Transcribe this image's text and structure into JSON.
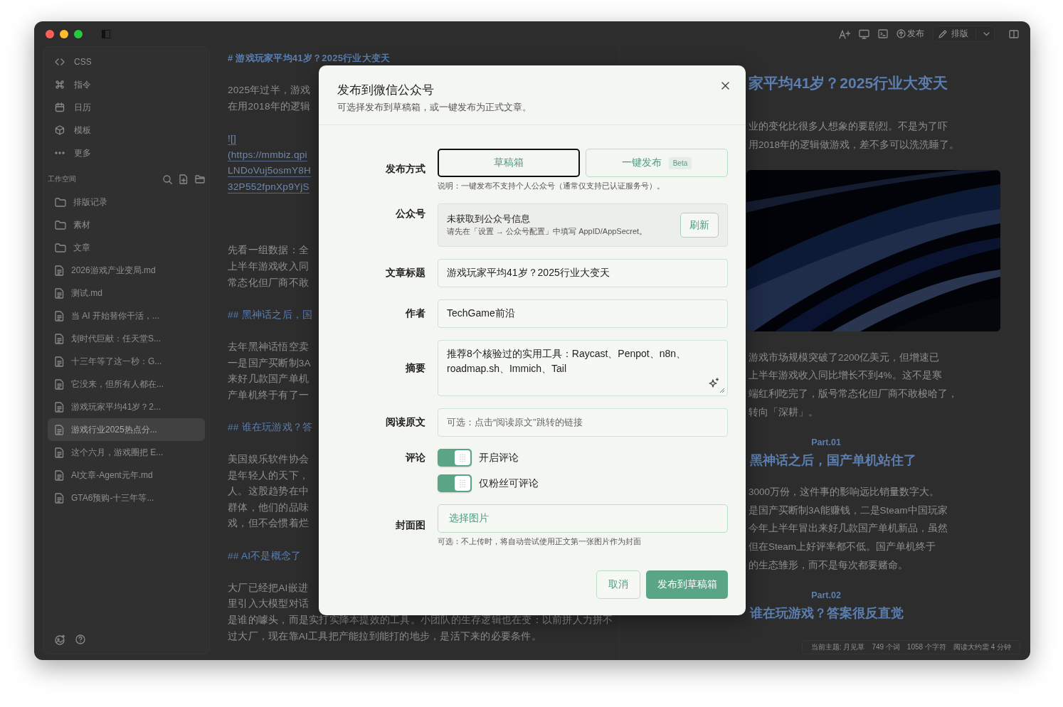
{
  "toolbar": {
    "publish": "发布",
    "layout": "排版"
  },
  "sidebar": {
    "nav": [
      {
        "kind": "code",
        "label": "CSS"
      },
      {
        "kind": "command",
        "label": "指令"
      },
      {
        "kind": "calendar",
        "label": "日历"
      },
      {
        "kind": "cube",
        "label": "模板"
      },
      {
        "kind": "more",
        "label": "更多"
      }
    ],
    "workspace": {
      "title": "工作空间",
      "items": [
        {
          "kind": "folder",
          "label": "排版记录",
          "selected": false
        },
        {
          "kind": "folder",
          "label": "素材",
          "selected": false
        },
        {
          "kind": "folder",
          "label": "文章",
          "selected": false
        },
        {
          "kind": "file",
          "label": "2026游戏产业变局.md",
          "selected": false
        },
        {
          "kind": "file",
          "label": "测试.md",
          "selected": false
        },
        {
          "kind": "file",
          "label": "当 AI 开始替你干活，...",
          "selected": false
        },
        {
          "kind": "file",
          "label": "划时代巨献：任天堂S...",
          "selected": false
        },
        {
          "kind": "file",
          "label": "十三年等了这一秒：G...",
          "selected": false
        },
        {
          "kind": "file",
          "label": "它没来，但所有人都在...",
          "selected": false
        },
        {
          "kind": "file",
          "label": "游戏玩家平均41岁？2...",
          "selected": false
        },
        {
          "kind": "file",
          "label": "游戏行业2025热点分...",
          "selected": true
        },
        {
          "kind": "file",
          "label": "这个六月，游戏圈把 E...",
          "selected": false
        },
        {
          "kind": "file",
          "label": "AI文章-Agent元年.md",
          "selected": false
        },
        {
          "kind": "file",
          "label": "GTA6预购-十三年等...",
          "selected": false
        }
      ]
    }
  },
  "editor": {
    "blocks": [
      {
        "kind": "heading",
        "lines": [
          "# 游戏玩家平均41岁？2025行业大变天"
        ]
      },
      {
        "kind": "para",
        "lines": [
          "2025年过半，游戏",
          "在用2018年的逻辑"
        ]
      },
      {
        "kind": "link",
        "lines": [
          "![]",
          "(https://mmbiz.qpi",
          "LNDoVuj5osmY8H",
          "32P552fpnXp9YjS"
        ]
      },
      {
        "kind": "para",
        "lines": [
          "先看一组数据：全",
          "上半年游戏收入同",
          "常态化但厂商不敢"
        ]
      },
      {
        "kind": "heading",
        "lines": [
          "## 黑神话之后，国"
        ]
      },
      {
        "kind": "para",
        "lines": [
          "去年黑神话悟空卖",
          "一是国产买断制3A",
          "来好几款国产单机",
          "产单机终于有了一"
        ]
      },
      {
        "kind": "heading",
        "lines": [
          "## 谁在玩游戏？答"
        ]
      },
      {
        "kind": "para",
        "lines": [
          "美国娱乐软件协会",
          "是年轻人的天下，",
          "人。这股趋势在中",
          "群体，他们的品味",
          "戏，但不会惯着烂"
        ]
      },
      {
        "kind": "heading",
        "lines": [
          "## AI不是概念了"
        ]
      },
      {
        "kind": "para",
        "lines": [
          "大厂已经把AI嵌进",
          "里引入大模型对话",
          "是谁的噱头，而是实打实降本提效的工具。小团队的生存逻辑也在变：以前拼人力拼不",
          "过大厂，现在靠AI工具把产能拉到能打的地步，是活下来的必要条件。"
        ]
      }
    ]
  },
  "preview": {
    "blocks": [
      {
        "kind": "title",
        "lines": [
          "家平均41岁？2025行业大变天"
        ]
      },
      {
        "kind": "para",
        "lines": [
          "业的变化比很多人想象的要剧烈。不是为了吓",
          "用2018年的逻辑做游戏，差不多可以洗洗睡了。"
        ]
      },
      {
        "kind": "picture"
      },
      {
        "kind": "para",
        "lines": [
          "游戏市场规模突破了2200亿美元，但增速已",
          "上半年游戏收入同比增长不到4%。这不是寒",
          "端红利吃完了，版号常态化但厂商不敢梭哈了，",
          " 转向「深耕」。"
        ]
      },
      {
        "kind": "part",
        "lines": [
          "Part.01"
        ]
      },
      {
        "kind": "heading",
        "lines": [
          "黑神话之后，国产单机站住了"
        ]
      },
      {
        "kind": "para",
        "lines": [
          "3000万份，这件事的影响远比销量数字大。",
          "是国产买断制3A能赚钱，二是Steam中国玩家",
          "今年上半年冒出来好几款国产单机新品，虽然",
          " 但在Steam上好评率都不低。国产单机终于",
          "的生态雏形，而不是每次都要赌命。"
        ]
      },
      {
        "kind": "part",
        "lines": [
          "Part.02"
        ]
      },
      {
        "kind": "heading",
        "lines": [
          "谁在玩游戏？答案很反直觉"
        ]
      }
    ]
  },
  "status_bar": [
    "当前主题: 月见草",
    "749 个词",
    "1058 个字符",
    "阅读大约需 4 分钟"
  ],
  "dialog": {
    "title": "发布到微信公众号",
    "subtitle": "可选择发布到草稿箱，或一键发布为正式文章。",
    "fields": [
      {
        "kind": "mode",
        "label": "发布方式",
        "options": [
          {
            "label": "草稿箱",
            "selected": true
          },
          {
            "label": "一键发布",
            "badge": "Beta",
            "selected": false
          }
        ],
        "note": "说明：一键发布不支持个人公众号（通常仅支持已认证服务号）。"
      },
      {
        "kind": "account",
        "label": "公众号",
        "status": "未获取到公众号信息",
        "hint": "请先在「设置 → 公众号配置」中填写 AppID/AppSecret。",
        "button": "刷新"
      },
      {
        "kind": "input",
        "label": "文章标题",
        "value": "游戏玩家平均41岁？2025行业大变天"
      },
      {
        "kind": "input",
        "label": "作者",
        "value": "TechGame前沿"
      },
      {
        "kind": "textarea",
        "label": "摘要",
        "value": "推荐8个核验过的实用工具：Raycast、Penpot、n8n、roadmap.sh、Immich、Tail"
      },
      {
        "kind": "input",
        "label": "阅读原文",
        "placeholder": "可选：点击“阅读原文”跳转的链接"
      },
      {
        "kind": "toggles",
        "label": "评论",
        "toggles": [
          {
            "label": "开启评论",
            "on": true
          },
          {
            "label": "仅粉丝可评论",
            "on": true
          }
        ]
      },
      {
        "kind": "file",
        "label": "封面图",
        "button": "选择图片",
        "note": "可选：不上传时，将自动尝试使用正文第一张图片作为封面"
      }
    ],
    "buttons": [
      {
        "kind": "secondary",
        "label": "取消"
      },
      {
        "kind": "primary",
        "label": "发布到草稿箱"
      }
    ]
  }
}
